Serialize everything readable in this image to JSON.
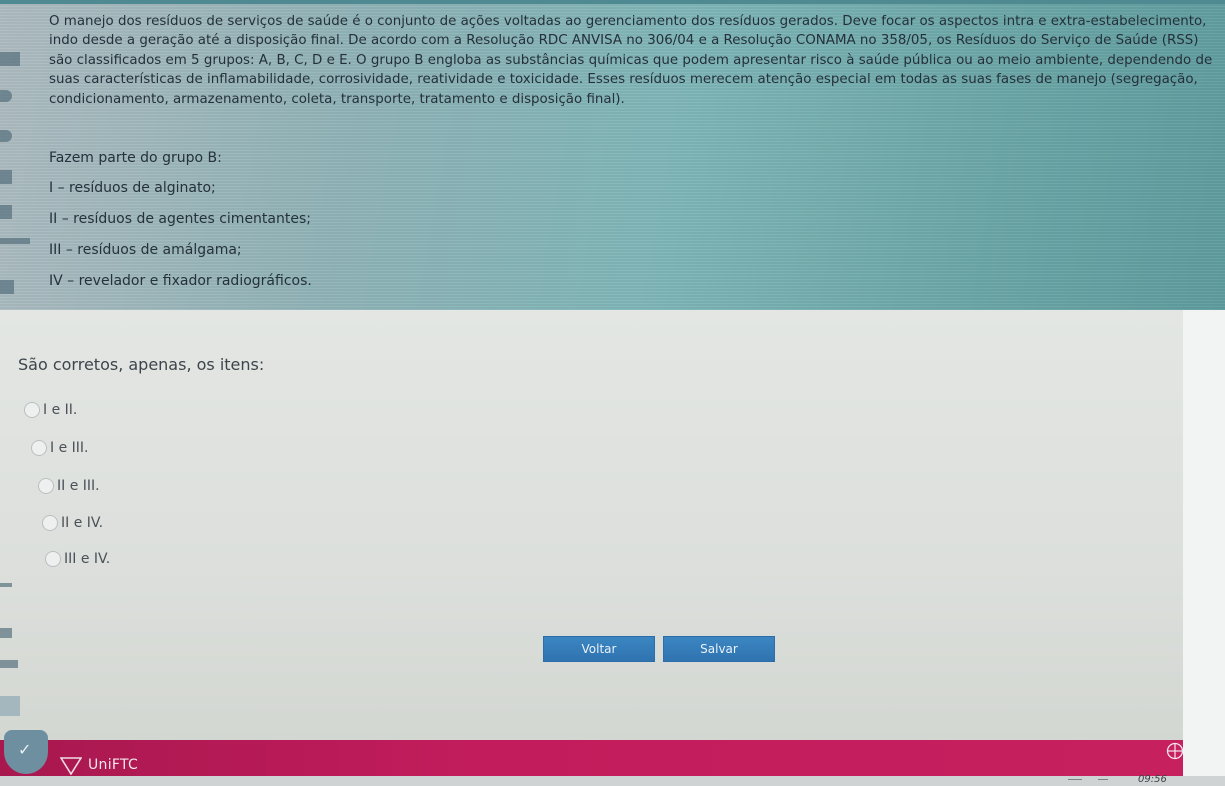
{
  "question": {
    "statement": "O manejo dos resíduos de serviços de saúde é o conjunto de ações voltadas ao gerenciamento dos resíduos gerados. Deve focar os aspectos intra e extra-estabelecimento, indo desde a geração até a disposição final. De acordo com a Resolução RDC ANVISA no 306/04 e a Resolução CONAMA no 358/05, os Resíduos do Serviço de Saúde (RSS) são classificados em 5 grupos: A, B, C, D e E. O grupo B engloba as substâncias químicas que podem apresentar risco à saúde pública ou ao meio ambiente, dependendo de suas características de inflamabilidade, corrosividade, reatividade e toxicidade. Esses resíduos merecem atenção especial em todas as suas fases de manejo (segregação, condicionamento, armazenamento, coleta, transporte, tratamento e disposição final).",
    "items_title": "Fazem parte do grupo B:",
    "items": [
      "I – resíduos de alginato;",
      "II – resíduos de agentes cimentantes;",
      "III – resíduos de amálgama;",
      "IV – revelador e fixador radiográficos."
    ],
    "prompt": "São corretos, apenas, os itens:",
    "options": [
      "I e II.",
      "I e III.",
      "II e III.",
      "II e IV.",
      "III e IV."
    ]
  },
  "buttons": {
    "back": "Voltar",
    "save": "Salvar"
  },
  "footer": {
    "brand": "UniFTC",
    "time": "09:56"
  },
  "colors": {
    "accent": "#c21c5c",
    "button": "#2f73b0",
    "teal": "#7fb6b8"
  }
}
